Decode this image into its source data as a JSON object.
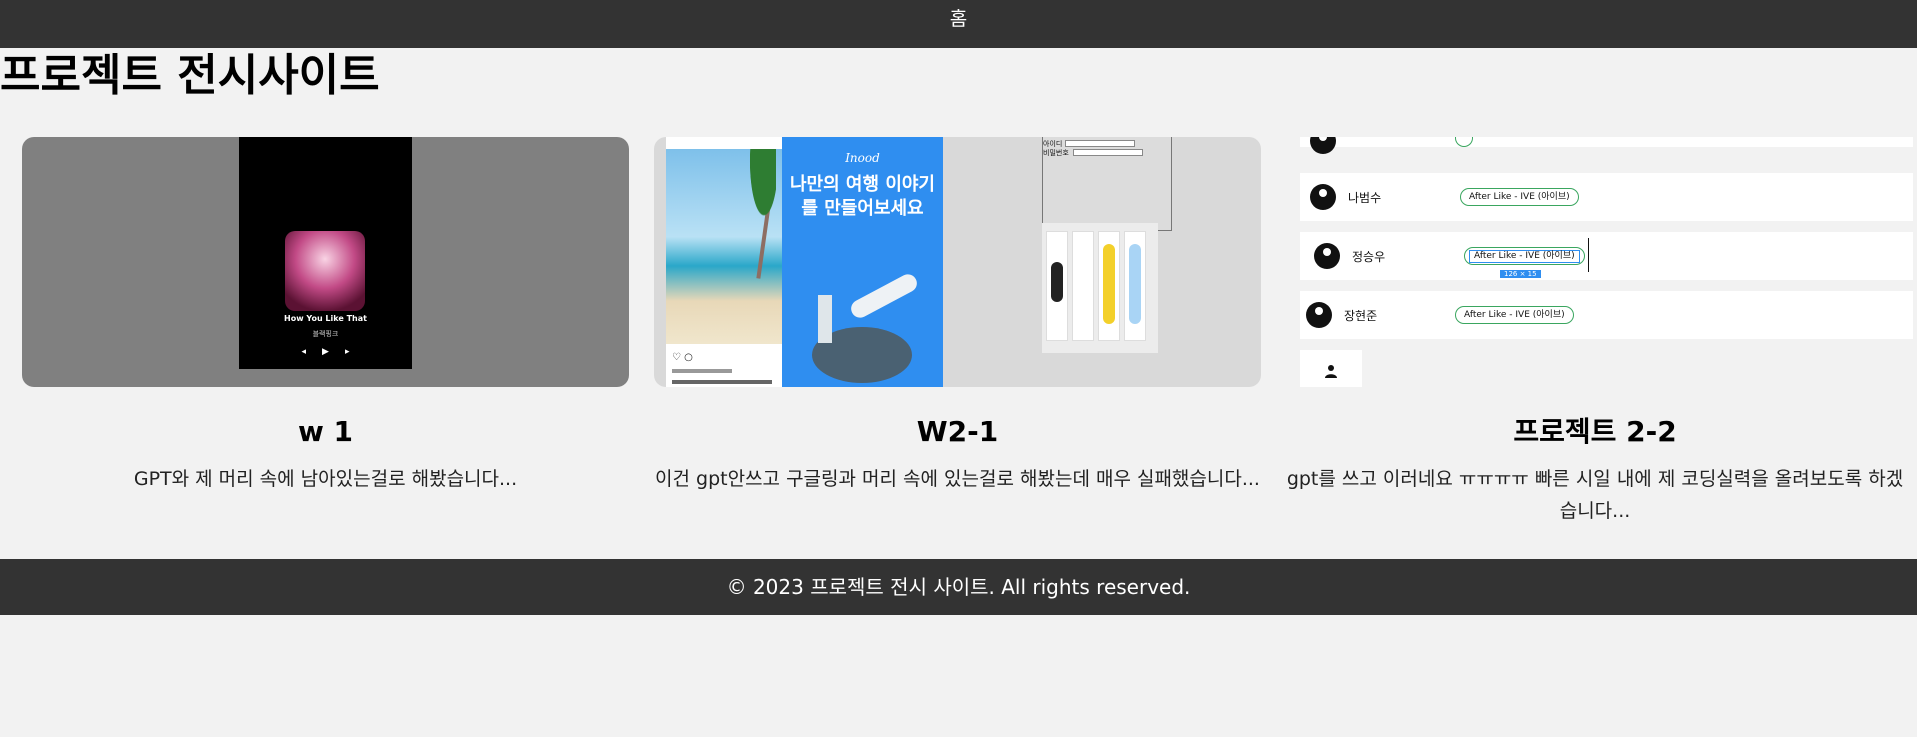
{
  "nav": {
    "home": "홈"
  },
  "page_title": "프로젝트 전시사이트",
  "projects": [
    {
      "title": "w 1",
      "desc": "GPT와 제 머리 속에 남아있는걸로 해봤습니다...",
      "thumb": {
        "song": "How You Like That",
        "artist": "블랙핑크"
      }
    },
    {
      "title": "W2-1",
      "desc": "이건 gpt안쓰고 구글링과 머리 속에 있는걸로 해봤는데 매우 실패했습니다...",
      "thumb": {
        "brand": "Inood",
        "slogan": "나만의 여행 이야기를 만들어보세요",
        "id_label": "아이디",
        "pw_label": "비밀번호"
      }
    },
    {
      "title": "프로젝트 2-2",
      "desc": "gpt를 쓰고 이러네요 ㅠㅠㅠㅠ 빠른 시일 내에 제 코딩실력을 올려보도록 하겠습니다...",
      "thumb": {
        "rows": [
          {
            "name": "나범수",
            "song": "After Like - IVE (아이브)"
          },
          {
            "name": "정승우",
            "song": "After Like - IVE (아이브)",
            "tip": "126 × 15"
          },
          {
            "name": "장현준",
            "song": "After Like - IVE (아이브)"
          }
        ]
      }
    }
  ],
  "footer": "© 2023 프로젝트 전시 사이트. All rights reserved."
}
